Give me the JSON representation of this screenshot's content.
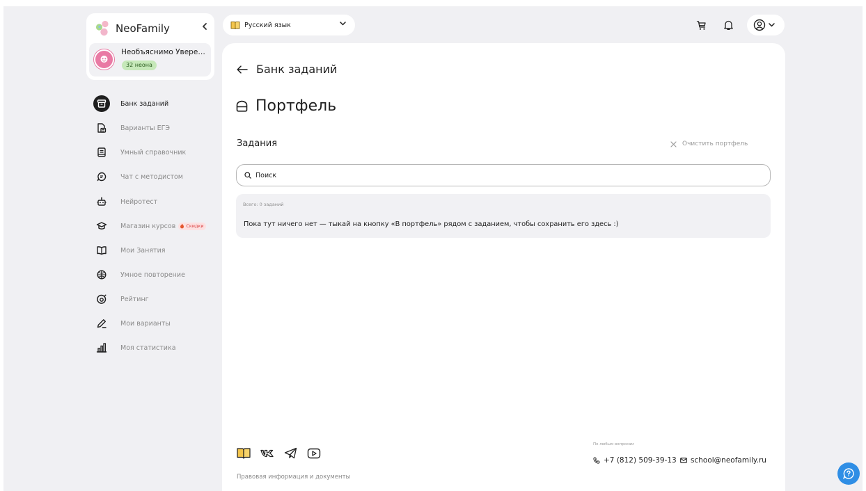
{
  "brand": {
    "name": "NeoFamily"
  },
  "user": {
    "name": "Необъяснимо Уверенн...",
    "balance": "32 неона"
  },
  "sidebar": {
    "items": [
      {
        "label": "Банк заданий",
        "icon": "box-icon",
        "active": true
      },
      {
        "label": "Варианты ЕГЭ",
        "icon": "document-icon"
      },
      {
        "label": "Умный справочник",
        "icon": "reference-book-icon"
      },
      {
        "label": "Чат с методистом",
        "icon": "chat-icon"
      },
      {
        "label": "Нейротест",
        "icon": "robot-icon"
      },
      {
        "label": "Магазин курсов",
        "icon": "graduation-cap-icon",
        "badge": "Скидки"
      },
      {
        "label": "Мои Занятия",
        "icon": "open-book-icon"
      },
      {
        "label": "Умное повторение",
        "icon": "brain-icon"
      },
      {
        "label": "Рейтинг",
        "icon": "target-icon"
      },
      {
        "label": "Мои варианты",
        "icon": "pencil-icon"
      },
      {
        "label": "Моя статистика",
        "icon": "bar-chart-icon"
      }
    ]
  },
  "topbar": {
    "subject": "Русский язык"
  },
  "main": {
    "back_label": "Банк заданий",
    "title": "Портфель",
    "section_title": "Задания",
    "clear_label": "Очистить портфель",
    "search_placeholder": "Поиск",
    "total_label": "Всего: 0 заданий",
    "empty_message": "Пока тут ничего нет — тыкай на кнопку «В портфель» рядом с заданием, чтобы сохранить его здесь :)"
  },
  "footer": {
    "legal_link": "Правовая информация и документы",
    "contact_caption": "По любым вопросам",
    "phone": "+7 (812) 509-39-13",
    "email": "school@neofamily.ru"
  },
  "colors": {
    "background": "#f0f0f3",
    "panel": "#ffffff",
    "active_nav": "#1f1f1f",
    "badge_green": "#c6e8b9",
    "sale_red": "#d94141",
    "help_blue": "#2f8ee5",
    "avatar_pink": "#e97aa4"
  }
}
